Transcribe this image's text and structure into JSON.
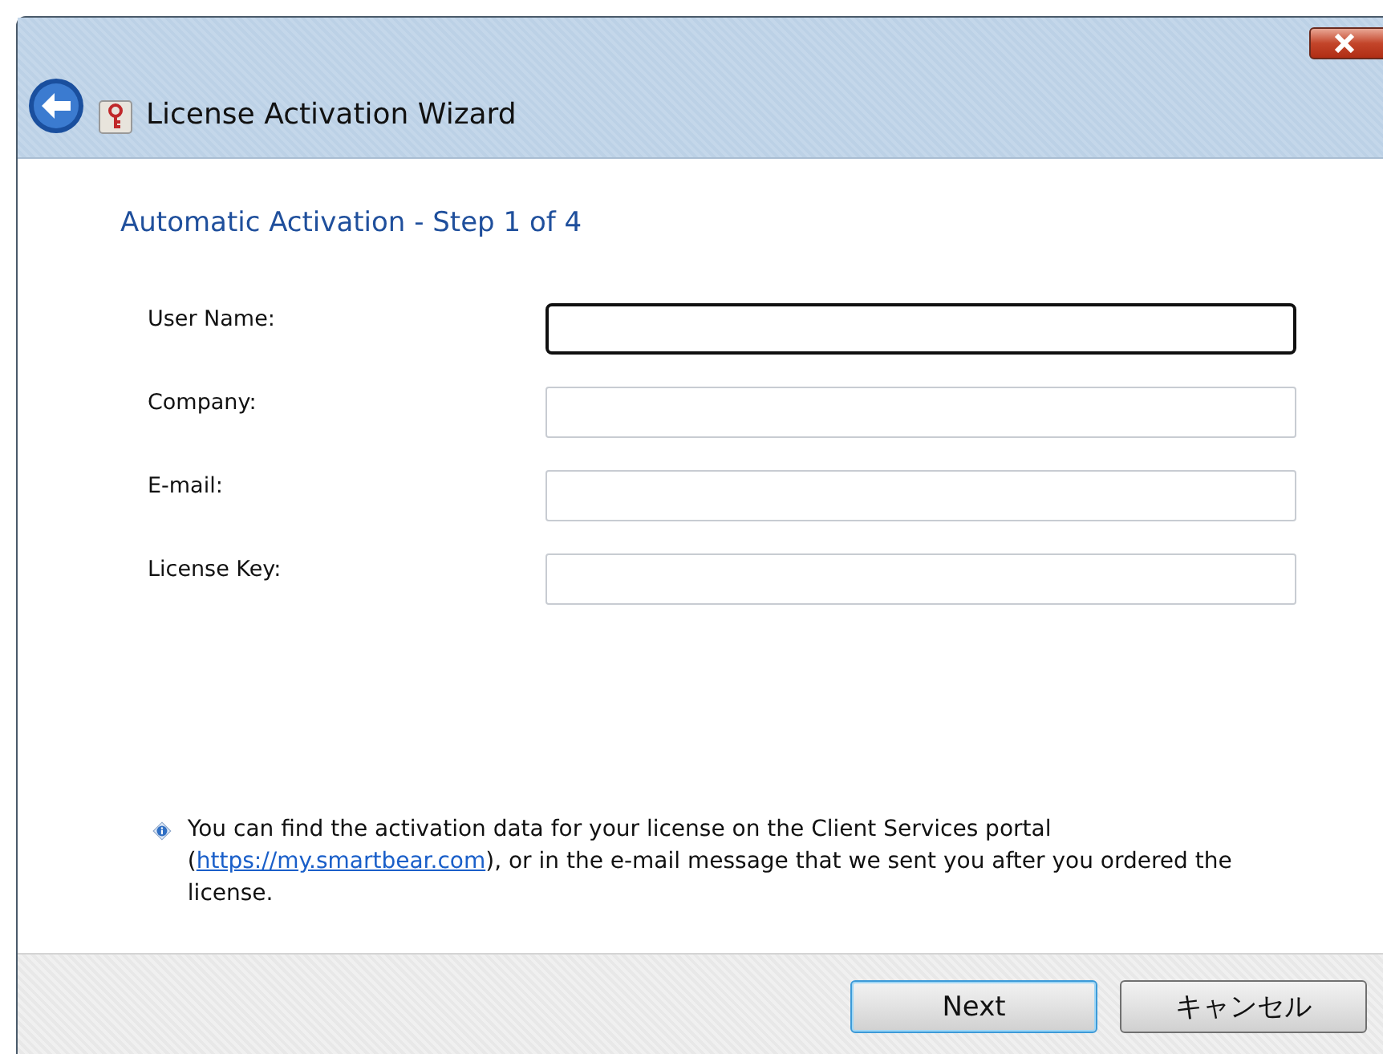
{
  "window": {
    "title": "License Activation Wizard"
  },
  "heading": "Automatic Activation - Step 1 of 4",
  "fields": [
    {
      "label": "User Name:",
      "focused": true
    },
    {
      "label": "Company:",
      "focused": false
    },
    {
      "label": "E-mail:",
      "focused": false
    },
    {
      "label": "License Key:",
      "focused": false
    }
  ],
  "note": {
    "before": "You can find the activation data for your license on the Client Services portal (",
    "link": "https://my.smartbear.com",
    "after": "), or in the e-mail message that we sent you after you ordered the license."
  },
  "buttons": [
    {
      "label": "Next",
      "default": true
    },
    {
      "label": "キャンセル",
      "default": false
    }
  ]
}
